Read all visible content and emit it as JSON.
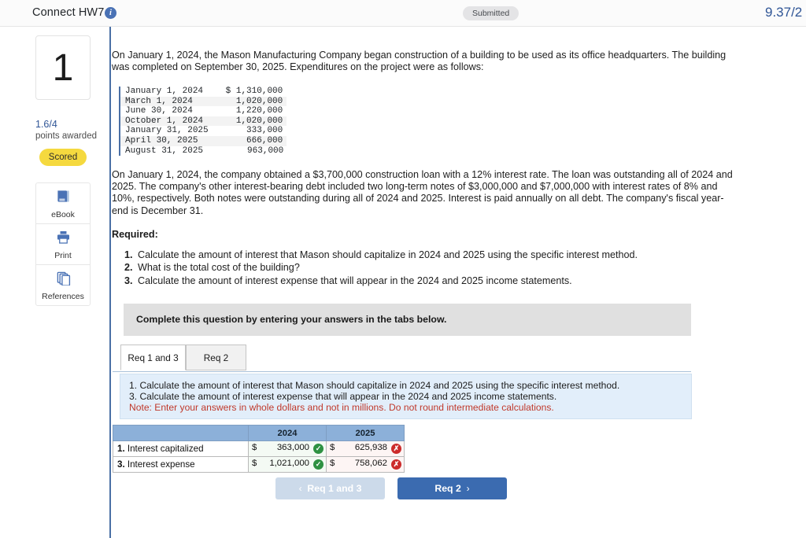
{
  "header": {
    "title": "Connect HW7",
    "info_icon": "info-icon",
    "status_badge": "Submitted",
    "score": "9.37/2"
  },
  "sidebar": {
    "question_number": "1",
    "points_value": "1.6/4",
    "points_label": "points awarded",
    "status_badge": "Scored",
    "tools": [
      {
        "icon": "book-icon",
        "label": "eBook"
      },
      {
        "icon": "printer-icon",
        "label": "Print"
      },
      {
        "icon": "copy-pages-icon",
        "label": "References"
      }
    ]
  },
  "question": {
    "paragraph_1": "On January 1, 2024, the Mason Manufacturing Company began construction of a building to be used as its office headquarters. The building was completed on September 30, 2025. Expenditures on the project were as follows:",
    "expenditures": {
      "rows": [
        {
          "date": "January 1, 2024",
          "currency": "$",
          "amount": "1,310,000"
        },
        {
          "date": "March 1, 2024",
          "currency": "",
          "amount": "1,020,000"
        },
        {
          "date": "June 30, 2024",
          "currency": "",
          "amount": "1,220,000"
        },
        {
          "date": "October 1, 2024",
          "currency": "",
          "amount": "1,020,000"
        },
        {
          "date": "January 31, 2025",
          "currency": "",
          "amount": "333,000"
        },
        {
          "date": "April 30, 2025",
          "currency": "",
          "amount": "666,000"
        },
        {
          "date": "August 31, 2025",
          "currency": "",
          "amount": "963,000"
        }
      ]
    },
    "paragraph_2": "On January 1, 2024, the company obtained a $3,700,000 construction loan with a 12% interest rate. The loan was outstanding all of 2024 and 2025. The company's other interest-bearing debt included two long-term notes of $3,000,000 and $7,000,000 with interest rates of 8% and 10%, respectively. Both notes were outstanding during all of 2024 and 2025. Interest is paid annually on all debt. The company's fiscal year-end is December 31.",
    "required_heading": "Required:",
    "required_items": [
      "Calculate the amount of interest that Mason should capitalize in 2024 and 2025 using the specific interest method.",
      "What is the total cost of the building?",
      "Calculate the amount of interest expense that will appear in the 2024 and 2025 income statements."
    ]
  },
  "answer_area": {
    "complete_banner": "Complete this question by entering your answers in the tabs below.",
    "tabs": [
      {
        "label": "Req 1 and 3",
        "active": true
      },
      {
        "label": "Req 2",
        "active": false
      }
    ],
    "instructions": {
      "line_1": "1. Calculate the amount of interest that Mason should capitalize in 2024 and 2025 using the specific interest method.",
      "line_2": "3. Calculate the amount of interest expense that will appear in the 2024 and 2025 income statements.",
      "note": "Note: Enter your answers in whole dollars and not in millions. Do not round intermediate calculations."
    },
    "table": {
      "headers": [
        "",
        "2024",
        "2025"
      ],
      "rows": [
        {
          "number": "1.",
          "label": " Interest capitalized",
          "y2024": {
            "currency": "$",
            "value": "363,000",
            "mark": "check-icon",
            "status": "correct"
          },
          "y2025": {
            "currency": "$",
            "value": "625,938",
            "mark": "x-icon",
            "status": "wrong"
          }
        },
        {
          "number": "3.",
          "label": " Interest expense",
          "y2024": {
            "currency": "$",
            "value": "1,021,000",
            "mark": "check-icon",
            "status": "correct"
          },
          "y2025": {
            "currency": "$",
            "value": "758,062",
            "mark": "x-icon",
            "status": "wrong"
          }
        }
      ]
    },
    "nav": {
      "prev_label": "Req 1 and 3",
      "prev_chevron": "‹",
      "next_label": "Req 2",
      "next_chevron": "›"
    }
  },
  "colors": {
    "accent_blue": "#3b6bb0",
    "header_blue": "#8cb0d9",
    "correct_green": "#2e9142",
    "wrong_red": "#cc2b2b",
    "note_red": "#c0392b",
    "scored_yellow": "#f5d93f",
    "panel_blue": "#e2eefa"
  }
}
